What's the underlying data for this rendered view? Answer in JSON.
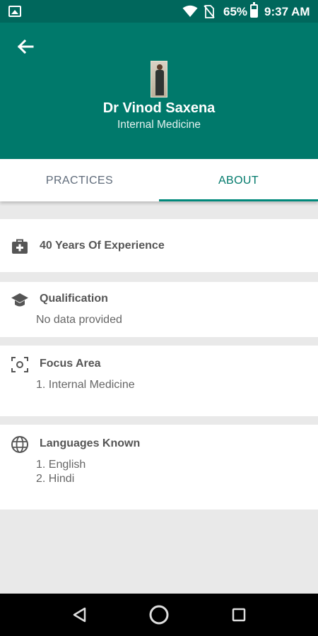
{
  "status_bar": {
    "battery_percent": "65%",
    "battery_level": 0.65,
    "time": "9:37 AM",
    "icons": [
      "picture-icon",
      "wifi-icon",
      "no-sim-icon",
      "battery-icon"
    ]
  },
  "header": {
    "doctor_name": "Dr Vinod Saxena",
    "specialty": "Internal Medicine",
    "back_icon": "arrow-left-icon",
    "background_color": "#00796b"
  },
  "tabs": {
    "practices_label": "PRACTICES",
    "about_label": "ABOUT",
    "selected": "ABOUT",
    "accent_color": "#00897b"
  },
  "about": {
    "experience": {
      "title": "40 Years Of Experience",
      "icon": "medical-bag-icon"
    },
    "qualification": {
      "title": "Qualification",
      "value": "No data provided",
      "icon": "graduation-cap-icon"
    },
    "focus_area": {
      "title": "Focus Area",
      "items": [
        "1. Internal Medicine"
      ],
      "icon": "focus-frame-icon"
    },
    "languages": {
      "title": "Languages Known",
      "items": [
        "1. English",
        "2. Hindi"
      ],
      "icon": "globe-icon"
    }
  },
  "nav_bar": {
    "icons": [
      "back-triangle-icon",
      "home-circle-icon",
      "recents-square-icon"
    ]
  }
}
